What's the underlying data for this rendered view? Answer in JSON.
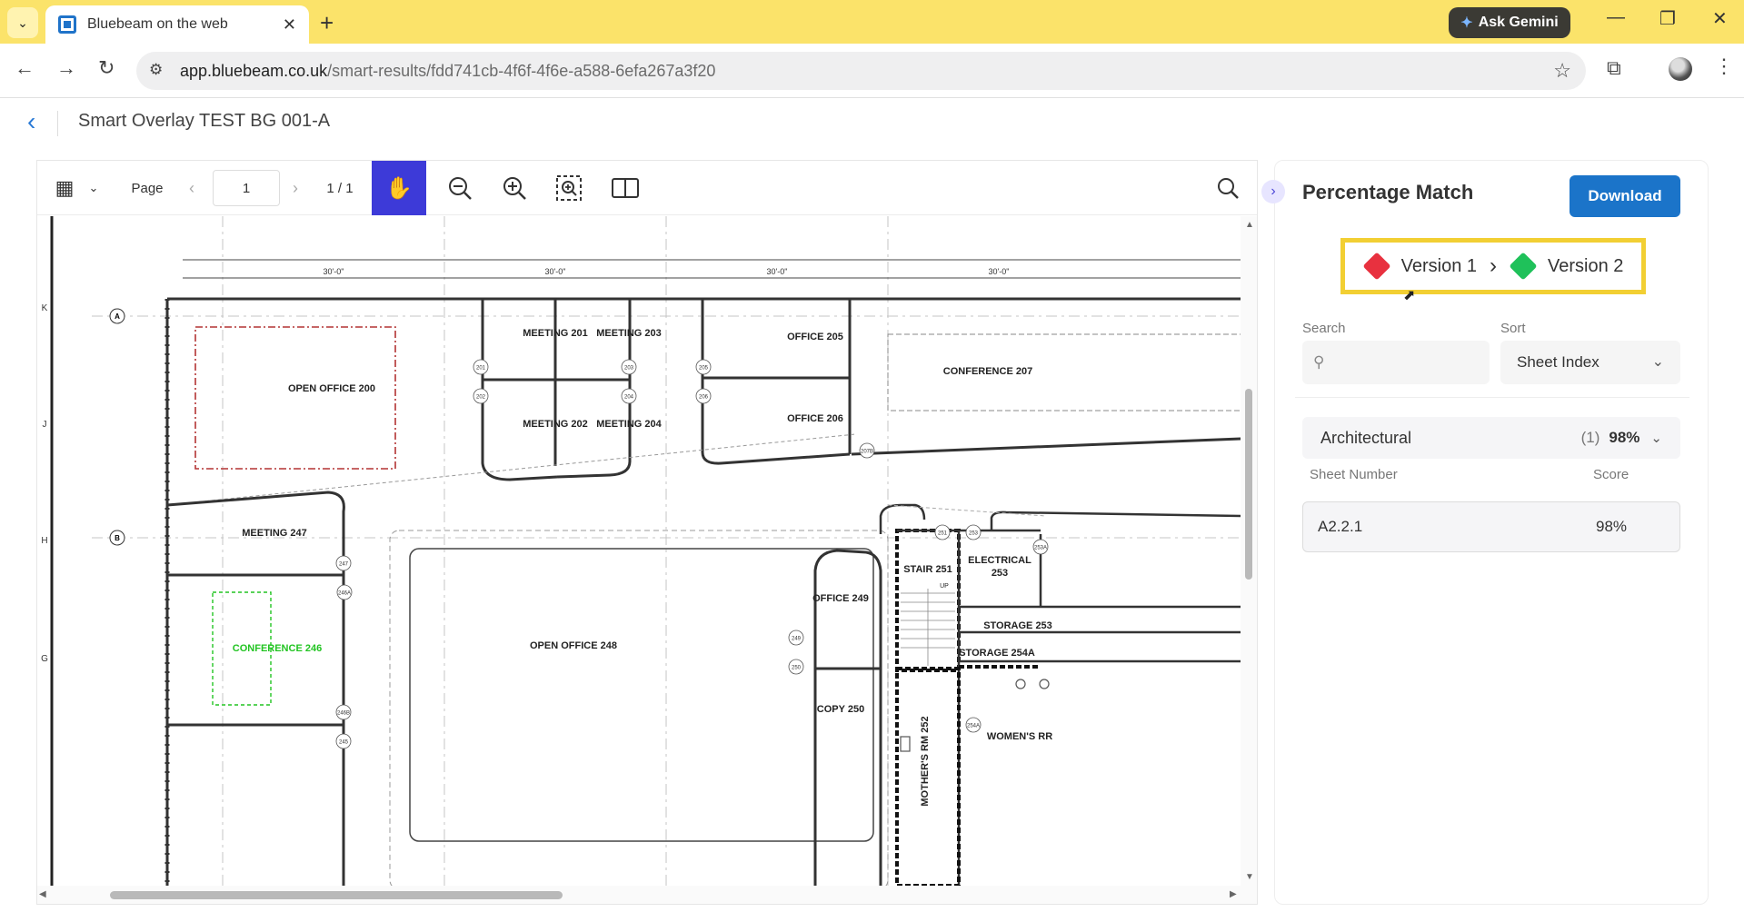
{
  "browser": {
    "tab_title": "Bluebeam on the web",
    "new_tab": "+",
    "gemini_label": "Ask Gemini",
    "url_host": "app.bluebeam.co.uk",
    "url_path": "/smart-results/fdd741cb-4f6f-4f6e-a588-6efa267a3f20",
    "colors": {
      "tabstrip": "#fbe36a"
    }
  },
  "header": {
    "title": "Smart Overlay TEST BG 001-A"
  },
  "viewer": {
    "page_label": "Page",
    "page_value": "1",
    "page_count": "1 / 1",
    "drawing": {
      "dimensions": [
        "30'-0\"",
        "30'-0\"",
        "30'-0\"",
        "30'-0\""
      ],
      "row_grid": [
        "K",
        "J",
        "H",
        "G"
      ],
      "bubbles": [
        "A",
        "B"
      ],
      "rooms": [
        "OPEN OFFICE 200",
        "MEETING 201",
        "MEETING 203",
        "MEETING 202",
        "MEETING 204",
        "OFFICE 205",
        "OFFICE 206",
        "CONFERENCE 207",
        "MEETING 247",
        "CONFERENCE 246",
        "OPEN OFFICE 248",
        "OFFICE 249",
        "COPY 250",
        "STAIR 251",
        "ELECTRICAL",
        "253",
        "STORAGE 253",
        "STORAGE 254A",
        "MOTHER'S RM 252",
        "WOMEN'S RR"
      ],
      "door_tags": [
        "201",
        "202",
        "203",
        "204",
        "205",
        "206",
        "207B",
        "247",
        "246A",
        "246B",
        "245",
        "249",
        "250",
        "251",
        "253",
        "253A",
        "254A"
      ],
      "stair_up": "UP",
      "colors": {
        "removed": "#b33434",
        "added": "#22c422"
      }
    }
  },
  "panel": {
    "title": "Percentage Match",
    "download_label": "Download",
    "version_1": "Version 1",
    "version_2": "Version 2",
    "version_colors": {
      "v1": "#e8313f",
      "v2": "#1fc15a",
      "highlight": "#f2cf33"
    },
    "search_label": "Search",
    "search_placeholder": "",
    "sort_label": "Sort",
    "sort_value": "Sheet Index",
    "group": {
      "name": "Architectural",
      "count": "(1)",
      "score": "98%"
    },
    "columns": {
      "sheet_number": "Sheet Number",
      "score": "Score"
    },
    "rows": [
      {
        "sheet_number": "A2.2.1",
        "score": "98%"
      }
    ],
    "accent": "#1b74c9"
  }
}
